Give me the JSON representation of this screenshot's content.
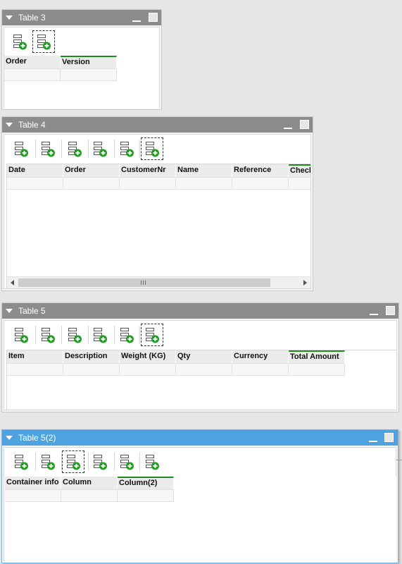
{
  "colors": {
    "header_inactive": "#8c8c8c",
    "header_active": "#4da3e0",
    "accent_column": "#1f8b1f",
    "add_icon_green": "#1e9e1e"
  },
  "icons": {
    "toolbar_button": "add-row-icon",
    "collapse": "collapse-triangle-icon",
    "minimize": "minimize-icon",
    "maximize": "maximize-icon"
  },
  "panels": [
    {
      "title": "Table 3",
      "active": false,
      "columns": [
        "Order",
        "Version"
      ],
      "accent_column": 1,
      "selected_button": 1
    },
    {
      "title": "Table 4",
      "active": false,
      "columns": [
        "Date",
        "Order",
        "CustomerNr",
        "Name",
        "Reference",
        "Check"
      ],
      "accent_column": 5,
      "selected_button": 5,
      "scrollbar_grip": "|||"
    },
    {
      "title": "Table 5",
      "active": false,
      "columns": [
        "Item",
        "Description",
        "Weight (KG)",
        "Qty",
        "Currency",
        "Total Amount"
      ],
      "accent_column": 5,
      "selected_button": 5
    },
    {
      "title": "Table 5(2)",
      "active": true,
      "columns": [
        "Container info",
        "Column",
        "Column(2)"
      ],
      "accent_column": 2,
      "selected_button": 2
    }
  ]
}
